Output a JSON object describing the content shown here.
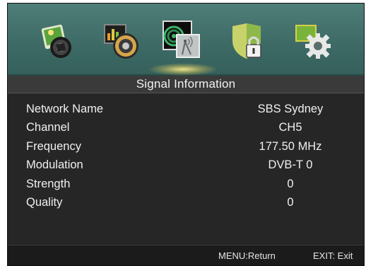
{
  "menu_icons": [
    {
      "name": "picture-icon"
    },
    {
      "name": "sound-icon"
    },
    {
      "name": "channel-icon",
      "selected": true
    },
    {
      "name": "lock-icon"
    },
    {
      "name": "setup-icon"
    }
  ],
  "title": "Signal Information",
  "rows": [
    {
      "label": "Network Name",
      "value": "SBS Sydney"
    },
    {
      "label": "Channel",
      "value": "CH5"
    },
    {
      "label": "Frequency",
      "value": "177.50 MHz"
    },
    {
      "label": "Modulation",
      "value": "DVB-T 0"
    },
    {
      "label": "Strength",
      "value": "0"
    },
    {
      "label": "Quality",
      "value": "0"
    }
  ],
  "footer": {
    "menu_hint": "MENU:Return",
    "exit_hint": "EXIT: Exit"
  },
  "colors": {
    "icon_bar": "#3e6b66",
    "panel": "#262626",
    "title_bar": "#3a3a3a",
    "text": "#f0f0f0"
  }
}
